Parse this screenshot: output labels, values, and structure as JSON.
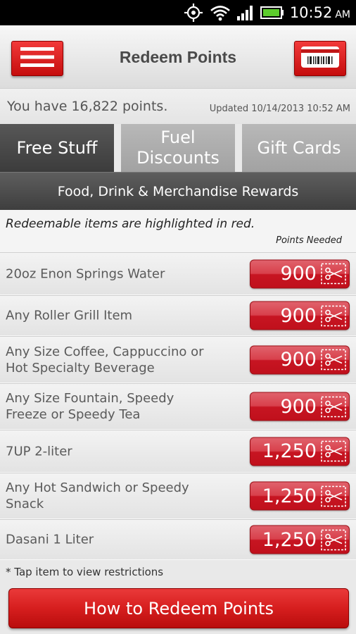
{
  "status_bar": {
    "time": "10:52",
    "ampm": "AM",
    "icons": [
      "gps-icon",
      "wifi-icon",
      "signal-icon",
      "battery-icon"
    ]
  },
  "header": {
    "title": "Redeem Points",
    "menu_icon": "hamburger-menu-icon",
    "card_icon": "barcode-card-icon"
  },
  "points": {
    "text": "You have 16,822 points.",
    "updated": "Updated 10/14/2013 10:52 AM"
  },
  "tabs": [
    {
      "label": "Free Stuff",
      "active": true
    },
    {
      "label": "Fuel\nDiscounts",
      "active": false
    },
    {
      "label": "Gift Cards",
      "active": false
    }
  ],
  "section_title": "Food, Drink & Merchandise Rewards",
  "legend": {
    "note": "Redeemable items are highlighted in red.",
    "points_needed": "Points Needed"
  },
  "items": [
    {
      "name": "20oz Enon Springs Water",
      "points": "900"
    },
    {
      "name": "Any Roller Grill Item",
      "points": "900"
    },
    {
      "name": "Any Size Coffee, Cappuccino or Hot Specialty Beverage",
      "points": "900"
    },
    {
      "name": "Any Size Fountain, Speedy Freeze or Speedy Tea",
      "points": "900"
    },
    {
      "name": "7UP 2-liter",
      "points": "1,250"
    },
    {
      "name": "Any Hot Sandwich or Speedy Snack",
      "points": "1,250"
    },
    {
      "name": "Dasani 1 Liter",
      "points": "1,250"
    }
  ],
  "footnote": "* Tap item to view restrictions",
  "redeem_button": "How to Redeem Points",
  "colors": {
    "brand_red": "#d61e1e",
    "dark_tab": "#4a4a4a",
    "inactive_tab": "#aaaaaa"
  }
}
